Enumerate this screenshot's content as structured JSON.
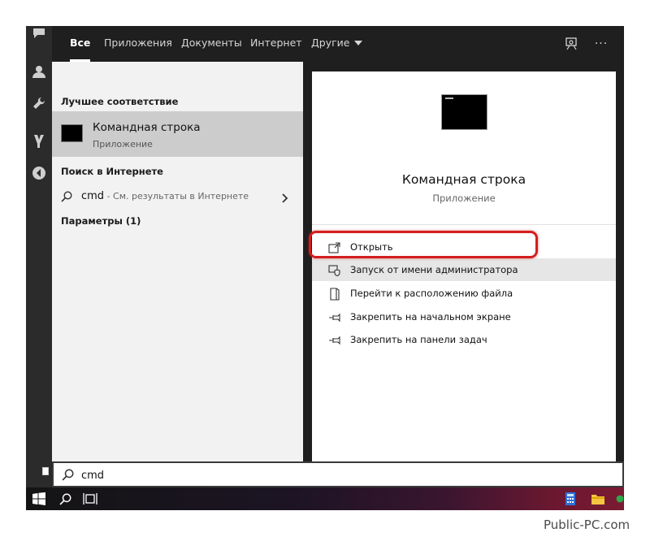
{
  "tabs": [
    {
      "label": "Все",
      "active": true
    },
    {
      "label": "Приложения",
      "active": false
    },
    {
      "label": "Документы",
      "active": false
    },
    {
      "label": "Интернет",
      "active": false
    },
    {
      "label": "Другие",
      "active": false
    }
  ],
  "top_icons": [
    "feedback-icon",
    "more-options-icon"
  ],
  "top_more_label": "···",
  "results": {
    "best_match_heading": "Лучшее соответствие",
    "best_match": {
      "title": "Командная строка",
      "subtitle": "Приложение",
      "icon": "cmd-app-icon"
    },
    "web_heading": "Поиск в Интернете",
    "web_result": {
      "query": "cmd",
      "hint": " - См. результаты в Интернете"
    },
    "settings_heading": "Параметры (1)"
  },
  "detail": {
    "title": "Командная строка",
    "subtitle": "Приложение",
    "actions": [
      {
        "label": "Открыть",
        "icon": "open-icon"
      },
      {
        "label": "Запуск от имени администратора",
        "icon": "admin-shield-icon",
        "highlighted": true
      },
      {
        "label": "Перейти к расположению файла",
        "icon": "file-location-icon"
      },
      {
        "label": "Закрепить на начальном экране",
        "icon": "pin-icon"
      },
      {
        "label": "Закрепить на панели задач",
        "icon": "pin-icon"
      }
    ]
  },
  "search": {
    "value": "cmd"
  },
  "watermark": "Public-PC.com",
  "colors": {
    "highlight_ring": "#d31f1f",
    "best_match_bg": "#cccccc",
    "topbar_bg": "#1f1f1f"
  }
}
